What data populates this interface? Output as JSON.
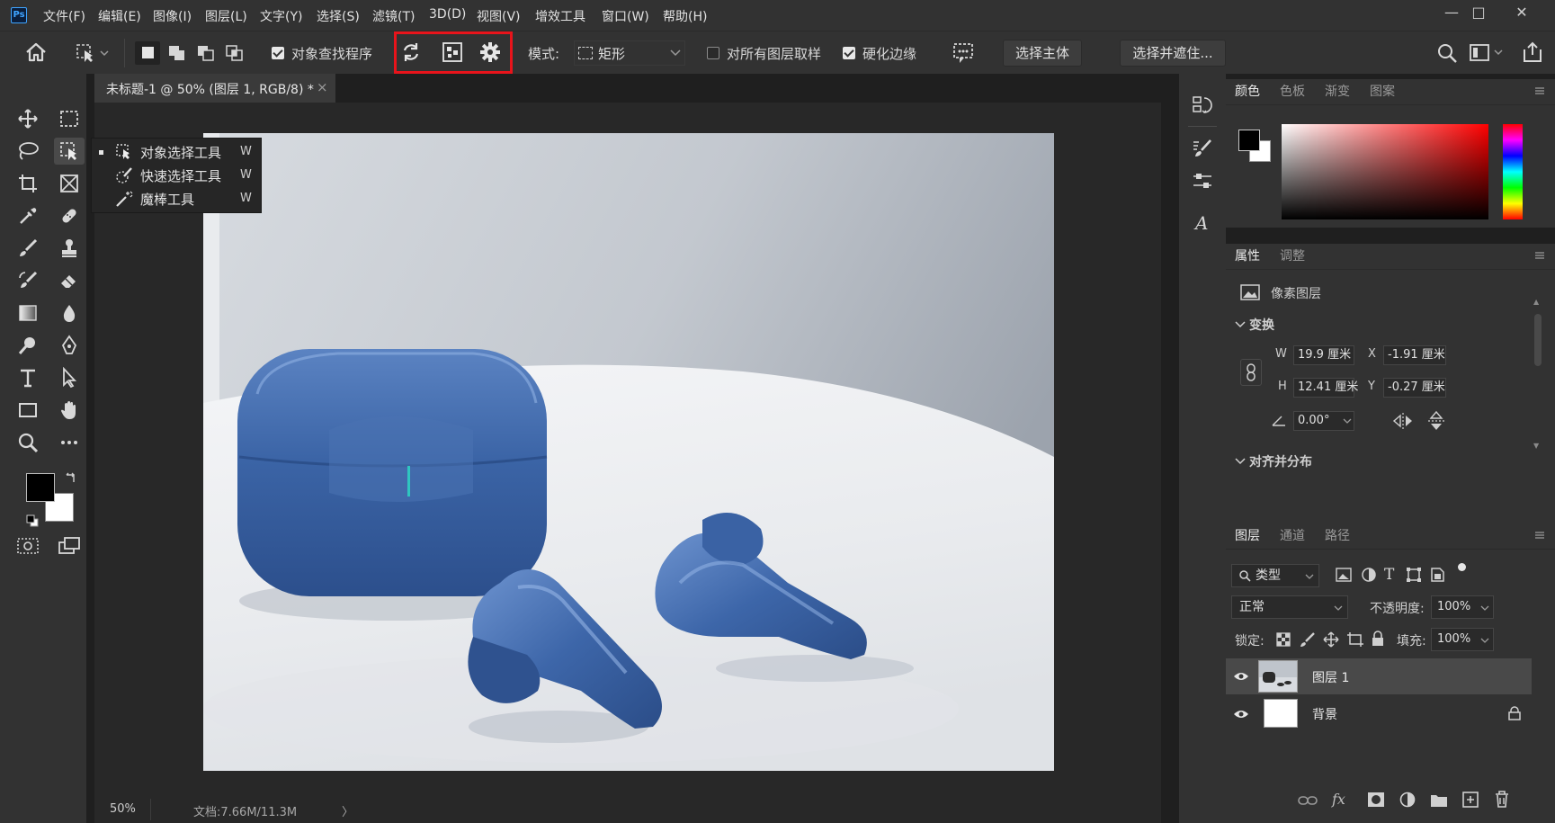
{
  "app": {
    "logo": "Ps"
  },
  "menu": [
    "文件(F)",
    "编辑(E)",
    "图像(I)",
    "图层(L)",
    "文字(Y)",
    "选择(S)",
    "滤镜(T)",
    "3D(D)",
    "视图(V)",
    "增效工具",
    "窗口(W)",
    "帮助(H)"
  ],
  "window_controls": {
    "minimize": "—",
    "maximize": "□",
    "close": "✕"
  },
  "options": {
    "object_finder_label": "对象查找程序",
    "object_finder_checked": true,
    "mode_label": "模式:",
    "mode_value": "矩形",
    "sample_all_label": "对所有图层取样",
    "sample_all_checked": false,
    "hard_edge_label": "硬化边缘",
    "hard_edge_checked": true,
    "select_subject_label": "选择主体",
    "select_mask_label": "选择并遮住..."
  },
  "doc_tab": {
    "title": "未标题-1 @ 50% (图层 1, RGB/8) *",
    "close": "×"
  },
  "flyout": [
    {
      "label": "对象选择工具",
      "key": "W",
      "active": true
    },
    {
      "label": "快速选择工具",
      "key": "W",
      "active": false
    },
    {
      "label": "魔棒工具",
      "key": "W",
      "active": false
    }
  ],
  "status": {
    "zoom": "50%",
    "doc_info": "文档:7.66M/11.3M",
    "arrow": "〉"
  },
  "color_panel": {
    "tabs": [
      "颜色",
      "色板",
      "渐变",
      "图案"
    ],
    "foreground": "#000000",
    "background": "#ffffff"
  },
  "properties_panel": {
    "tabs": [
      "属性",
      "调整"
    ],
    "layer_type": "像素图层",
    "transform_title": "变换",
    "w_label": "W",
    "w_value": "19.9 厘米",
    "x_label": "X",
    "x_value": "-1.91 厘米",
    "h_label": "H",
    "h_value": "12.41 厘米",
    "y_label": "Y",
    "y_value": "-0.27 厘米",
    "angle_value": "0.00°",
    "align_title": "对齐并分布"
  },
  "layers_panel": {
    "tabs": [
      "图层",
      "通道",
      "路径"
    ],
    "filter_label": "类型",
    "blend_mode": "正常",
    "opacity_label": "不透明度:",
    "opacity_value": "100%",
    "lock_label": "锁定:",
    "fill_label": "填充:",
    "fill_value": "100%",
    "layers": [
      {
        "name": "图层 1",
        "selected": true
      },
      {
        "name": "背景",
        "selected": false
      }
    ]
  },
  "colors": {
    "highlight_box": "#e8141b",
    "accent_cyan": "#2fc6c0",
    "earbuds_blue": "#3b64a6"
  }
}
